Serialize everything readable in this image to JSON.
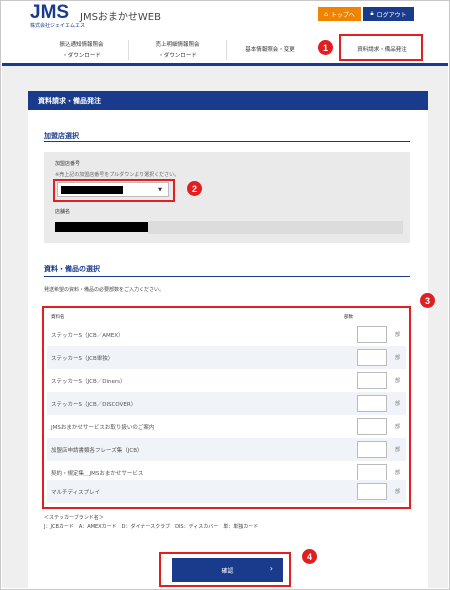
{
  "header": {
    "logo": "JMS",
    "logo_sub": "株式会社ジェイエムエス",
    "site_title": "JMSおまかせWEB",
    "top_button": "トップへ",
    "logout_button": "ログアウト"
  },
  "nav": {
    "items": [
      {
        "line1": "振込通知情報照会",
        "line2": "・ダウンロード"
      },
      {
        "line1": "売上明細情報照会",
        "line2": "・ダウンロード"
      },
      {
        "line1": "基本情報照会・変更",
        "line2": ""
      },
      {
        "line1": "資料請求・備品発注",
        "line2": ""
      }
    ]
  },
  "panel": {
    "title": "資料請求・備品発注"
  },
  "store_select": {
    "section_title": "加盟店選択",
    "store_number_label": "加盟店番号",
    "hint": "※売上記の加盟店番号をプルダウンより選択ください。",
    "store_name_label": "店舗名"
  },
  "items_section": {
    "section_title": "資料・備品の選択",
    "description": "発送希望の資料・備品の必要部数をご入力ください。",
    "col_name": "資料名",
    "col_qty": "部数",
    "unit": "部",
    "rows": [
      "ステッカーS（JCB／AMEX）",
      "ステッカーS（JCB単独）",
      "ステッカーS（JCB／Diners）",
      "ステッカーS（JCB／DISCOVER）",
      "JMSおまかせサービスお取り扱いのご案内",
      "加盟店申請書類各フレーズ集（JCB）",
      "契約・規定集＿JMSおまかせサービス",
      "マルチディスプレイ"
    ]
  },
  "notes": {
    "line1": "＜ステッカーブランド名＞",
    "line2": "J：JCBカード　A：AMEXカード　D：ダイナースクラブ　DIS：ディスカバー　単：単独カード"
  },
  "confirm_button": "確認",
  "badges": [
    "1",
    "2",
    "3",
    "4"
  ],
  "colors": {
    "brand": "#1a3b8c",
    "accent": "#f08300",
    "annotation": "#e02020"
  }
}
